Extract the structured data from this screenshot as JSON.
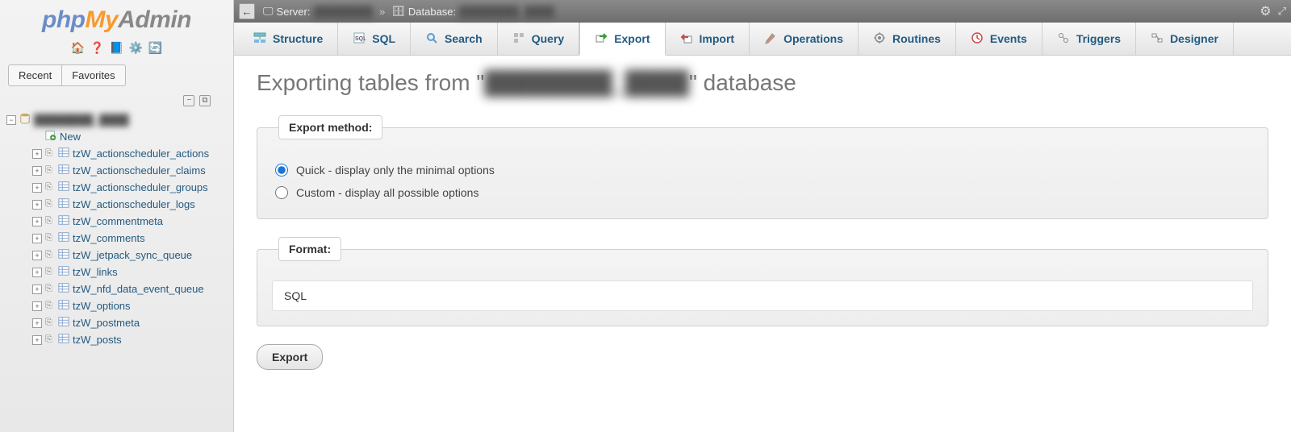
{
  "logo": {
    "php": "php",
    "my": "My",
    "admin": "Admin"
  },
  "sidebar_toolbar": [
    "home",
    "help",
    "doc",
    "settings",
    "reload"
  ],
  "recent_label": "Recent",
  "favorites_label": "Favorites",
  "db_name": "████████_████",
  "new_label": "New",
  "tables": [
    "tzW_actionscheduler_actions",
    "tzW_actionscheduler_claims",
    "tzW_actionscheduler_groups",
    "tzW_actionscheduler_logs",
    "tzW_commentmeta",
    "tzW_comments",
    "tzW_jetpack_sync_queue",
    "tzW_links",
    "tzW_nfd_data_event_queue",
    "tzW_options",
    "tzW_postmeta",
    "tzW_posts"
  ],
  "breadcrumbs": {
    "server_label": "Server:",
    "server_value": "████████",
    "database_label": "Database:",
    "database_value": "████████_████"
  },
  "tabs": [
    {
      "label": "Structure",
      "icon": "structure"
    },
    {
      "label": "SQL",
      "icon": "sql"
    },
    {
      "label": "Search",
      "icon": "search"
    },
    {
      "label": "Query",
      "icon": "query"
    },
    {
      "label": "Export",
      "icon": "export"
    },
    {
      "label": "Import",
      "icon": "import"
    },
    {
      "label": "Operations",
      "icon": "operations"
    },
    {
      "label": "Routines",
      "icon": "routines"
    },
    {
      "label": "Events",
      "icon": "events"
    },
    {
      "label": "Triggers",
      "icon": "triggers"
    },
    {
      "label": "Designer",
      "icon": "designer"
    }
  ],
  "active_tab": "Export",
  "heading_prefix": "Exporting tables from \"",
  "heading_dbname": "████████_████",
  "heading_suffix": "\" database",
  "export_method_legend": "Export method:",
  "radio_quick": "Quick - display only the minimal options",
  "radio_custom": "Custom - display all possible options",
  "format_legend": "Format:",
  "format_value": "SQL",
  "export_button": "Export"
}
